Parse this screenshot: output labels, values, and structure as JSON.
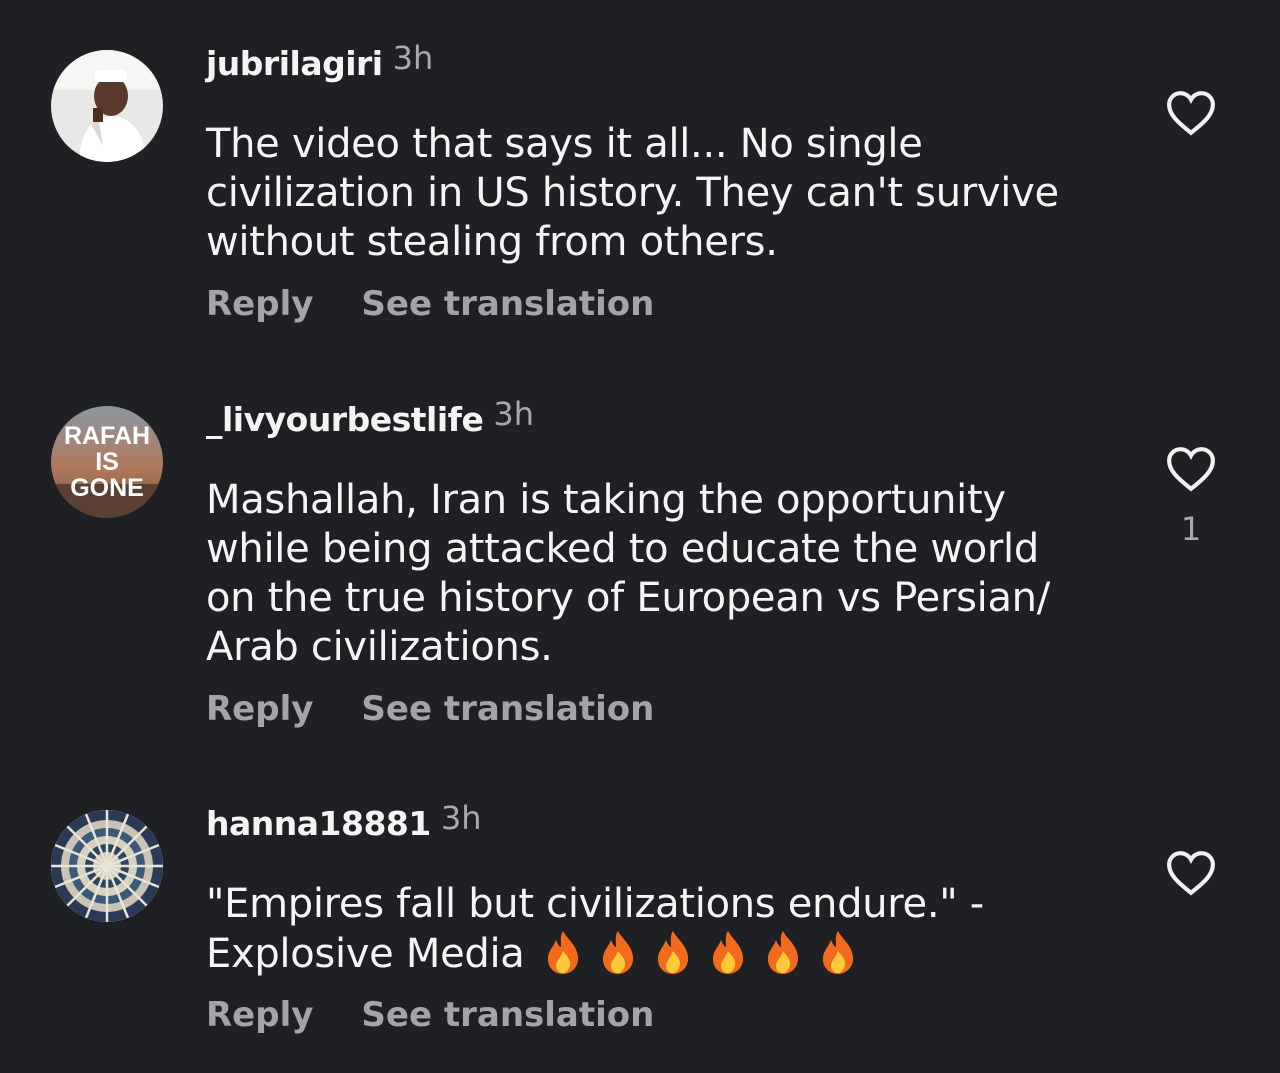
{
  "comments": [
    {
      "username": "jubrilagiri",
      "time": "3h",
      "text_lines": [
        "The video that says it all... No single",
        "civilization in US history. They can't survive",
        "without stealing from others."
      ],
      "reply_label": "Reply",
      "translation_label": "See translation",
      "like_count": ""
    },
    {
      "username": "_livyourbestlife",
      "time": "3h",
      "avatar_text": [
        "RAFAH",
        "IS",
        "GONE"
      ],
      "text_lines": [
        "Mashallah, Iran is taking the opportunity",
        "while being attacked to educate the world",
        "on the true history of European vs Persian/",
        "Arab civilizations."
      ],
      "reply_label": "Reply",
      "translation_label": "See translation",
      "like_count": "1"
    },
    {
      "username": "hanna18881",
      "time": "3h",
      "text_lines": [
        "\"Empires fall but civilizations endure.\" -",
        "Explosive Media"
      ],
      "emoji_count": 6,
      "reply_label": "Reply",
      "translation_label": "See translation",
      "like_count": ""
    }
  ],
  "icons": {
    "like": "heart-outline-icon",
    "emoji": "fire-emoji"
  },
  "colors": {
    "background": "#1f2024",
    "text": "#f5f5f5",
    "muted": "#a3a4a8"
  }
}
